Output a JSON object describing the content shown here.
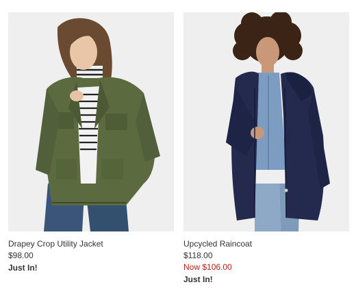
{
  "products": [
    {
      "name": "Drapey Crop Utility Jacket",
      "price": "$98.00",
      "badge": "Just In!"
    },
    {
      "name": "Upcycled Raincoat",
      "price": "$118.00",
      "sale_price": "Now $106.00",
      "badge": "Just In!"
    }
  ],
  "colors": {
    "text": "#333333",
    "sale": "#b3201f",
    "image_bg": "#efefef",
    "jacket_olive": "#5b6a3f",
    "raincoat_navy": "#232a4e",
    "denim": "#3b5a7e"
  }
}
